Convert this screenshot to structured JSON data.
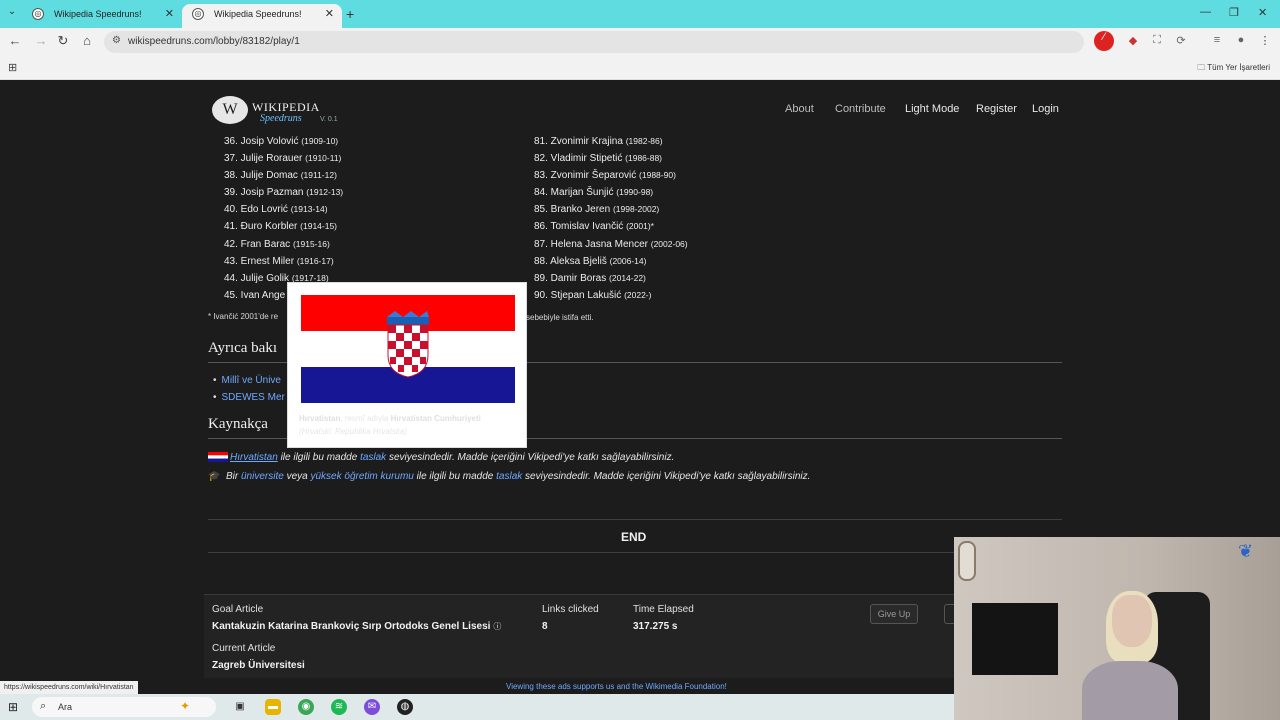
{
  "browser": {
    "tabs": [
      {
        "title": "Wikipedia Speedruns!"
      },
      {
        "title": "Wikipedia Speedruns!"
      }
    ],
    "url": "wikispeedruns.com/lobby/83182/play/1",
    "bookmarks_folder": "Tüm Yer İşaretleri"
  },
  "site": {
    "logo_title": "WIKIPEDIA",
    "logo_sub": "Speedruns",
    "logo_version": "V. 0.1",
    "nav": {
      "about": "About",
      "contribute": "Contribute",
      "light_mode": "Light Mode",
      "register": "Register",
      "login": "Login"
    }
  },
  "article": {
    "list_left": [
      {
        "name": "36. Josip Volović",
        "years": "(1909-10)"
      },
      {
        "name": "37. Julije Rorauer",
        "years": "(1910-11)"
      },
      {
        "name": "38. Julije Domac",
        "years": "(1911-12)"
      },
      {
        "name": "39. Josip Pazman",
        "years": "(1912-13)"
      },
      {
        "name": "40. Edo Lovrić",
        "years": "(1913-14)"
      },
      {
        "name": "41. Đuro Korbler",
        "years": "(1914-15)"
      },
      {
        "name": "42. Fran Barac",
        "years": "(1915-16)"
      },
      {
        "name": "43. Ernest Miler",
        "years": "(1916-17)"
      },
      {
        "name": "44. Julije Golik",
        "years": "(1917-18)"
      },
      {
        "name": "45. Ivan Ange",
        "years": ""
      }
    ],
    "list_right": [
      {
        "name": "81. Zvonimir Krajina",
        "years": "(1982-86)"
      },
      {
        "name": "82. Vladimir Stipetić",
        "years": "(1986-88)"
      },
      {
        "name": "83. Zvonimir Šeparović",
        "years": "(1988-90)"
      },
      {
        "name": "84. Marijan Šunjić",
        "years": "(1990-98)"
      },
      {
        "name": "85. Branko Jeren",
        "years": "(1998-2002)"
      },
      {
        "name": "86. Tomislav Ivančić",
        "years": "(2001)*"
      },
      {
        "name": "87. Helena Jasna Mencer",
        "years": "(2002-06)"
      },
      {
        "name": "88. Aleksa Bjeliš",
        "years": "(2006-14)"
      },
      {
        "name": "89. Damir Boras",
        "years": "(2014-22)"
      },
      {
        "name": "90. Stjepan Lakušić",
        "years": "(2022-)"
      }
    ],
    "footnote_start": "* Ivančić 2001'de re",
    "footnote_end": "sebebiyle istifa etti.",
    "see_also_heading": "Ayrıca bakı",
    "see_also": [
      "Millî ve Ünive",
      "SDEWES Mer"
    ],
    "references_heading": "Kaynakça",
    "stub1": {
      "link": "Hırvatistan",
      "text1": " ile ilgili bu madde ",
      "link2": "taslak",
      "text2": " seviyesindedir. Madde içeriğini Vikipedi'ye katkı sağlayabilirsiniz."
    },
    "stub2": {
      "text0": "Bir ",
      "link1": "üniversite",
      "text1": " veya ",
      "link2": "yüksek öğretim kurumu",
      "text2": " ile ilgili bu madde ",
      "link3": "taslak",
      "text3": " seviyesindedir. Madde içeriğini Vikipedi'ye katkı sağlayabilirsiniz."
    },
    "end_label": "END"
  },
  "popup": {
    "caption_bold": "Hırvatistan",
    "caption_mid": ", resmî adıyla ",
    "caption_bold2": "Hırvatistan Cumhuriyeti",
    "caption_end": "(Hrvatski: Republika Hrvatska)"
  },
  "game": {
    "goal_label": "Goal Article",
    "goal_value": "Kantakuzin Katarina Brankoviç Sırp Ortodoks Genel Lisesi",
    "goal_info": "ⓘ",
    "links_label": "Links clicked",
    "links_value": "8",
    "time_label": "Time Elapsed",
    "time_value": "317.275 s",
    "current_label": "Current Article",
    "current_value": "Zagreb Üniversitesi",
    "give_up": "Give Up"
  },
  "status_url": "https://wikispeedruns.com/wiki/Hırvatistan",
  "ads_note": "Viewing these ads supports us and the Wikimedia Foundation!",
  "taskbar": {
    "search_placeholder": "Ara"
  },
  "colors": {
    "flag_red": "#ff0000",
    "flag_white": "#ffffff",
    "flag_blue": "#171796",
    "link": "#6ea8ff"
  }
}
